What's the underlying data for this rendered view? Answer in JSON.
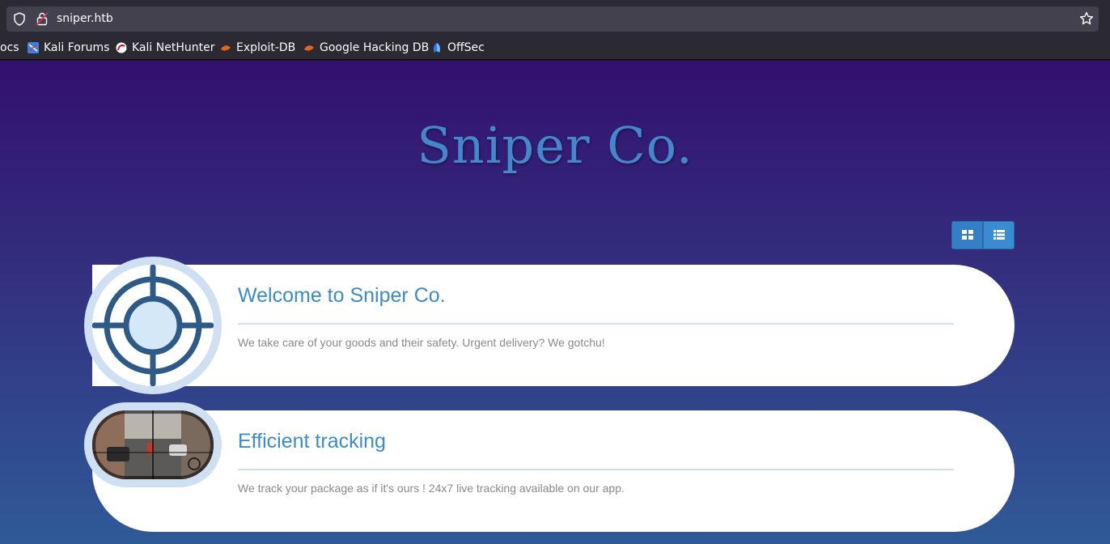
{
  "browser": {
    "url": "sniper.htb",
    "bookmarks": [
      {
        "label": "ocs",
        "icon": "kali-docs-icon"
      },
      {
        "label": "Kali Forums",
        "icon": "kali-forums-icon"
      },
      {
        "label": "Kali NetHunter",
        "icon": "kali-nethunter-icon"
      },
      {
        "label": "Exploit-DB",
        "icon": "exploit-db-icon"
      },
      {
        "label": "Google Hacking DB",
        "icon": "google-hacking-db-icon"
      },
      {
        "label": "OffSec",
        "icon": "offsec-icon"
      }
    ]
  },
  "site": {
    "title": "Sniper Co.",
    "view_toggle": {
      "grid_icon": "grid-view-icon",
      "list_icon": "list-view-icon"
    },
    "cards": [
      {
        "heading": "Welcome to Sniper Co.",
        "description": "We take care of your goods and their safety. Urgent delivery? We gotchu!",
        "icon": "crosshair-icon"
      },
      {
        "heading": "Efficient tracking",
        "description": "We track your package as if it's ours ! 24x7 live tracking available on our app.",
        "icon": "scope-photo"
      }
    ]
  },
  "colors": {
    "accent": "#3d8bc7",
    "title": "#4488cc",
    "gradient_top": "#33106e",
    "gradient_bottom": "#2f5a98"
  }
}
